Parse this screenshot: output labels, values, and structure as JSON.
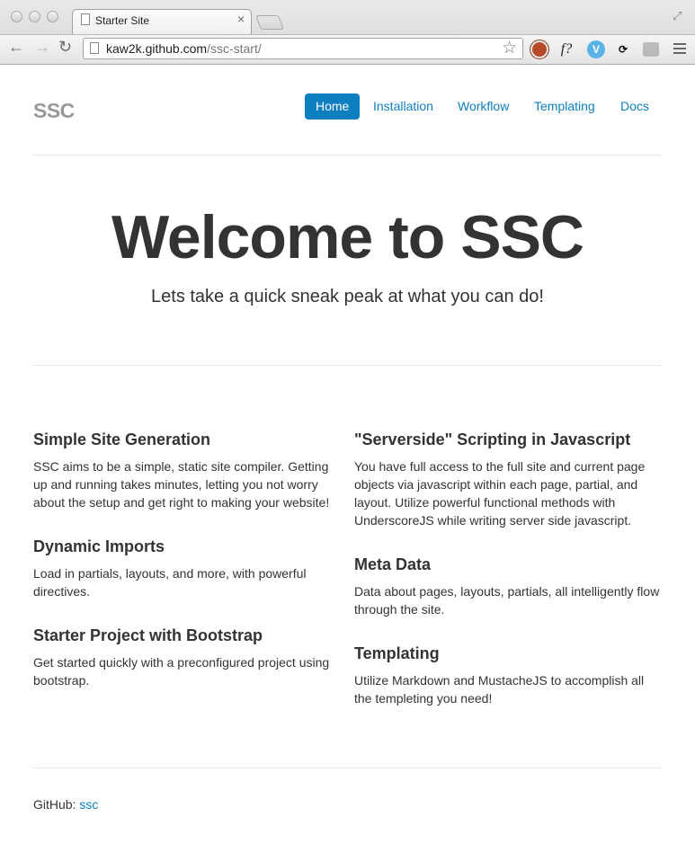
{
  "browser": {
    "tab_title": "Starter Site",
    "tab_close": "×",
    "url_host": "kaw2k.github.com",
    "url_path": "/ssc-start/",
    "back": "←",
    "forward": "→",
    "reload": "↻",
    "star": "☆",
    "fullscreen": "⤢",
    "ext_f": "f?"
  },
  "site": {
    "brand": "SSC",
    "nav": [
      {
        "label": "Home",
        "active": true
      },
      {
        "label": "Installation"
      },
      {
        "label": "Workflow"
      },
      {
        "label": "Templating"
      },
      {
        "label": "Docs"
      }
    ]
  },
  "hero": {
    "title": "Welcome to SSC",
    "subtitle": "Lets take a quick sneak peak at what you can do!"
  },
  "features": {
    "left": [
      {
        "title": "Simple Site Generation",
        "body": "SSC aims to be a simple, static site compiler. Getting up and running takes minutes, letting you not worry about the setup and get right to making your website!"
      },
      {
        "title": "Dynamic Imports",
        "body": "Load in partials, layouts, and more, with powerful directives."
      },
      {
        "title": "Starter Project with Bootstrap",
        "body": "Get started quickly with a preconfigured project using bootstrap."
      }
    ],
    "right": [
      {
        "title": "\"Serverside\" Scripting in Javascript",
        "body": "You have full access to the full site and current page objects via javascript within each page, partial, and layout. Utilize powerful functional methods with UnderscoreJS while writing server side javascript."
      },
      {
        "title": "Meta Data",
        "body": "Data about pages, layouts, partials, all intelligently flow through the site."
      },
      {
        "title": "Templating",
        "body": "Utilize Markdown and MustacheJS to accomplish all the templeting you need!"
      }
    ]
  },
  "footer": {
    "label": "GitHub:",
    "link": "ssc"
  },
  "colors": {
    "accent": "#0d7fc1",
    "text": "#333333",
    "brand": "#999999"
  }
}
